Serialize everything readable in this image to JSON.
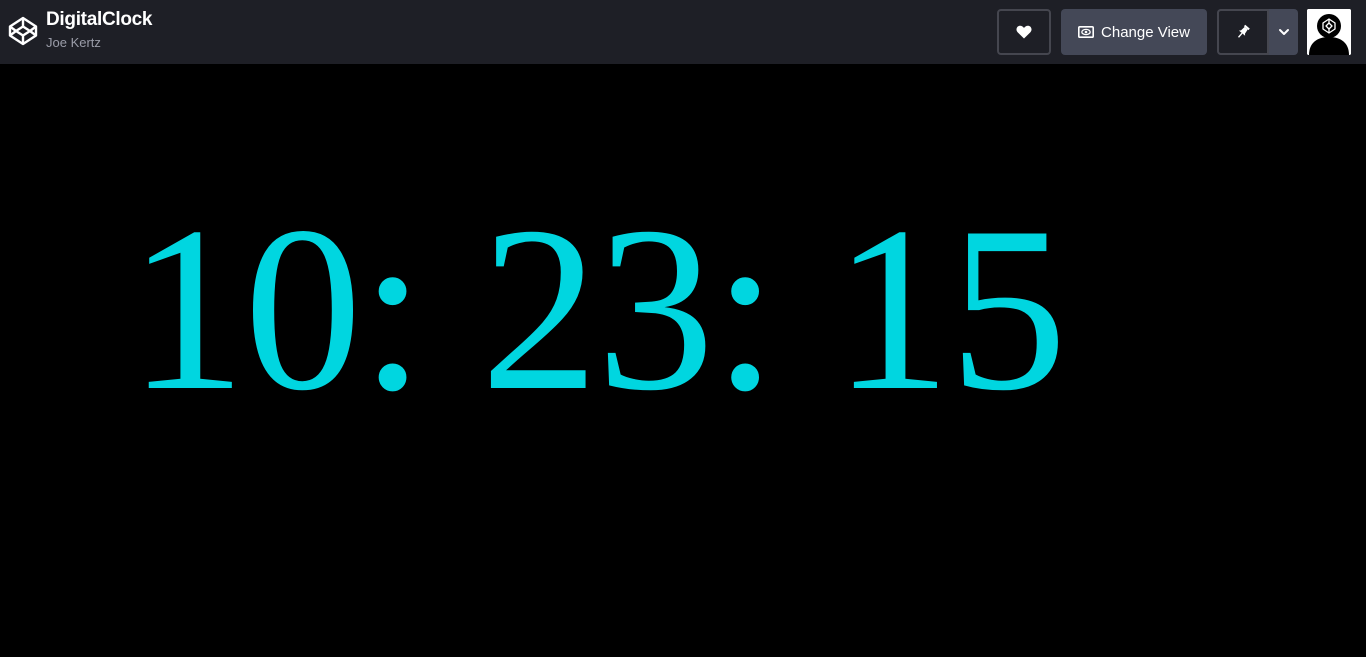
{
  "header": {
    "title": "DigitalClock",
    "author": "Joe Kertz",
    "logo_icon": "codepen-logo-icon",
    "buttons": {
      "heart_icon": "heart-icon",
      "change_view_label": "Change View",
      "change_view_icon": "eye-icon",
      "pin_icon": "pin-icon",
      "dropdown_icon": "chevron-down-icon"
    },
    "avatar_icon": "user-avatar-icon"
  },
  "clock": {
    "time": "10: 23: 15"
  },
  "colors": {
    "clock_text": "#00d6e0",
    "header_bg": "#1e1f26",
    "button_bg": "#444857",
    "page_bg": "#000000"
  }
}
